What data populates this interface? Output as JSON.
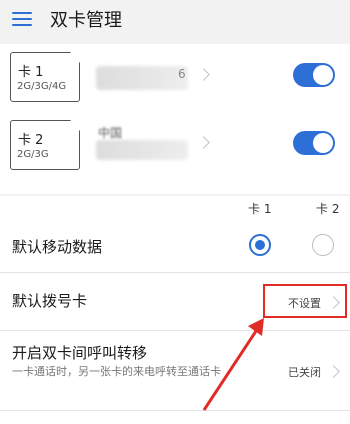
{
  "header": {
    "title": "双卡管理"
  },
  "sims": [
    {
      "name": "卡 1",
      "network": "2G/3G/4G",
      "digit": "6",
      "enabled": true
    },
    {
      "name": "卡 2",
      "network": "2G/3G",
      "carrier": "中国",
      "enabled": true
    }
  ],
  "columns": {
    "card1": "卡 1",
    "card2": "卡 2"
  },
  "default_data": {
    "label": "默认移动数据",
    "selected": "卡 1"
  },
  "default_dial": {
    "label": "默认拨号卡",
    "value": "不设置"
  },
  "call_forward": {
    "label": "开启双卡间呼叫转移",
    "description": "一卡通话时，另一张卡的来电呼转至通话卡",
    "value": "已关闭"
  },
  "colors": {
    "accent": "#2d6fd6",
    "annotation": "#e02b27"
  }
}
